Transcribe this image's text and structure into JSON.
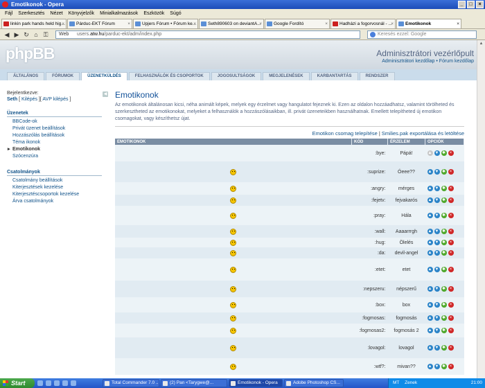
{
  "window": {
    "title": "Emotikonok - Opera"
  },
  "menu": [
    "Fájl",
    "Szerkesztés",
    "Nézet",
    "Könyvjelzők",
    "Minialkalmazások",
    "Eszközök",
    "Súgó"
  ],
  "tabs": [
    {
      "label": "linkin park hands held hig...",
      "yt": true
    },
    {
      "label": "Párduc-EKT Fórum",
      "yt": false
    },
    {
      "label": "Upjers Fórum • Fórum ke...",
      "yt": false
    },
    {
      "label": "Seth890603 on deviantA...",
      "yt": false
    },
    {
      "label": "Google Fordító",
      "yt": false
    },
    {
      "label": "Hadházi a fogorvosnál - ...",
      "yt": true
    },
    {
      "label": "Emotikonok",
      "yt": false,
      "active": true
    }
  ],
  "nav": {
    "web_label": "Web",
    "url_prefix": "users.",
    "url_host": "atw.hu",
    "url_path": "/parduc-ekt/adm/index.php",
    "search_placeholder": "Keresés ezzel: Google"
  },
  "header": {
    "logo": "phpBB",
    "title": "Adminisztrátori vezérlőpult",
    "link1": "Adminisztrátori kezdőlap",
    "link_sep": " • ",
    "link2": "Fórum kezdőlap"
  },
  "admin_tabs": [
    "Általános",
    "Fórumok",
    "Üzenetküldés",
    "Felhasználók és csoportok",
    "Jogosultságok",
    "Megjelenések",
    "Karbantartás",
    "Rendszer"
  ],
  "active_admin_tab": 2,
  "sidebar": {
    "login_label": "Bejelentkezve:",
    "user": "Seth",
    "logout": "Kilépés",
    "avp_logout": "AVP kilépés",
    "sec1_title": "Üzenetek",
    "sec1": [
      "BBCode-ok",
      "Privát üzenet beállítások",
      "Hozzászólás beállítások",
      "Téma ikonok",
      "Emotikonok",
      "Szócenzúra"
    ],
    "sec1_active": 4,
    "sec2_title": "Csatolmányok",
    "sec2": [
      "Csatolmány beállítások",
      "Kiterjesztések kezelése",
      "Kiterjesztéscsoportok kezelése",
      "Árva csatolmányok"
    ]
  },
  "main": {
    "title": "Emotikonok",
    "intro": "Az emotikonok általánosan kicsi, néha animált képek, melyek egy érzelmet vagy hangulatot fejeznek ki. Ezen az oldalon hozzáadhatsz, valamint törölheted és szerkesztheted az emotikonokat, melyeket a felhasználók a hozzászólásaikban, ill. privát üzeneteikben használhatnak. Emellett telepítheted új emotikon csomagokat, vagy készíthetsz újat.",
    "action1": "Emotikon csomag telepítése",
    "action_sep": "|",
    "action2": "Smilies.pak exportálása és letöltése",
    "headers": {
      "emoticons": "EMOTIKONOK",
      "code": "KÓD",
      "emotion": "ÉRZELEM",
      "options": "OPCIÓK"
    }
  },
  "rows": [
    {
      "code": ":bye:",
      "emotion": "Pápá!",
      "icon": "none",
      "h": 24,
      "first": true
    },
    {
      "code": ":suprize:",
      "emotion": "Óeee??",
      "icon": "smile",
      "h": 30
    },
    {
      "code": ":angry:",
      "emotion": "mérges",
      "icon": "smile",
      "h": 18
    },
    {
      "code": ":fejetv:",
      "emotion": "fejvakarós",
      "icon": "smile",
      "h": 16
    },
    {
      "code": ":pray:",
      "emotion": "Hála",
      "icon": "smile",
      "h": 28
    },
    {
      "code": ":wall:",
      "emotion": "Aaaarrrgh",
      "icon": "smile",
      "h": 18
    },
    {
      "code": ":hug:",
      "emotion": "Ölelés",
      "icon": "smile",
      "h": 14
    },
    {
      "code": ":da:",
      "emotion": "devil-angel",
      "icon": "smile",
      "h": 16
    },
    {
      "code": ":etet:",
      "emotion": "etet",
      "icon": "smile",
      "h": 32
    },
    {
      "code": ":nepszeru:",
      "emotion": "népszerű",
      "icon": "smile",
      "h": 24
    },
    {
      "code": ":box:",
      "emotion": "box",
      "icon": "smile",
      "h": 22
    },
    {
      "code": ":fogmosas:",
      "emotion": "fogmosás",
      "icon": "smile",
      "h": 16
    },
    {
      "code": ":fogmosas2:",
      "emotion": "fogmosás 2",
      "icon": "smile",
      "h": 20
    },
    {
      "code": ":lovagol:",
      "emotion": "lovagol",
      "icon": "smile",
      "h": 30
    },
    {
      "code": ":wtf?:",
      "emotion": "mivan??",
      "icon": "smile",
      "h": 24
    }
  ],
  "taskbar": {
    "start": "Start",
    "tasks": [
      {
        "label": "Total Commander 7.0 ...",
        "active": false
      },
      {
        "label": "(2) Pan <Tarygwe@...",
        "active": false
      },
      {
        "label": "Emotikonok - Opera",
        "active": true
      },
      {
        "label": "Adobe Photoshop CS...",
        "active": false
      }
    ],
    "lang": "MT",
    "zenek": "Zenek",
    "clock": "21:00"
  }
}
